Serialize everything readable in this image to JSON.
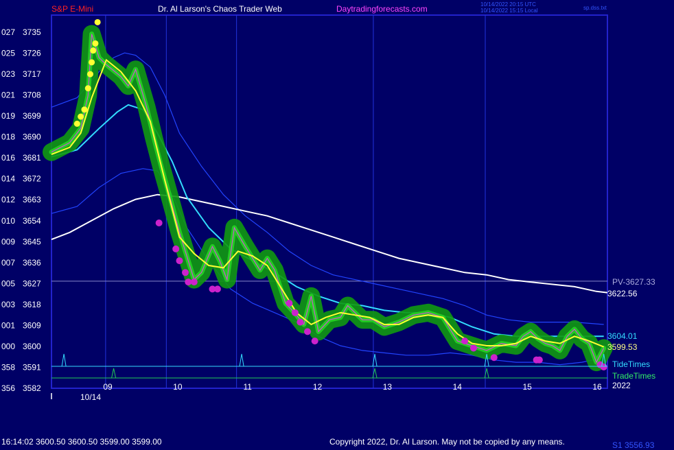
{
  "header": {
    "symbol": "S&P E-Mini",
    "title": "Dr. Al Larson's Chaos Trader Web",
    "site": "Daytradingforecasts.com",
    "utc_stamp": "10/14/2022 20:15 UTC",
    "local_stamp": "10/14/2022 15:15 Local",
    "file": "sp.dss.txt"
  },
  "footer": {
    "quote": "16:14:02  3600.50 3600.50 3599.00 3599.00",
    "copyright": "Copyright 2022, Dr. Al Larson. May not be copied by any means.",
    "cut_value": "S1 3556.93"
  },
  "markers": {
    "pv_label": "PV-3627.33",
    "pv_value": "3622.56",
    "cyan_value": "3604.01",
    "yellow_value": "3599.53",
    "tide": "TideTimes",
    "trade": "TradeTimes",
    "year": "2022",
    "date": "10/14"
  },
  "colors": {
    "background": "#000066",
    "frame": "#2222cc",
    "price": "#22cc22",
    "glow": "#119911",
    "yellow": "#ffff33",
    "cyan": "#33ddff",
    "white": "#ffffff",
    "blue": "#2244ff",
    "magenta": "#cc22cc",
    "header_red": "#ff2222",
    "header_magenta": "#ff44ff"
  },
  "chart_data": {
    "type": "line",
    "xlabel": "",
    "ylabel": "",
    "x_range": [
      8.55,
      16.15
    ],
    "ylim": [
      3582,
      3740
    ],
    "x_ticks": [
      "09",
      "10",
      "11",
      "12",
      "13",
      "14",
      "15",
      "16"
    ],
    "y_ticks": [
      {
        "code": "027",
        "price": "3735"
      },
      {
        "code": "025",
        "price": "3726"
      },
      {
        "code": "023",
        "price": "3717"
      },
      {
        "code": "021",
        "price": "3708"
      },
      {
        "code": "019",
        "price": "3699"
      },
      {
        "code": "018",
        "price": "3690"
      },
      {
        "code": "016",
        "price": "3681"
      },
      {
        "code": "014",
        "price": "3672"
      },
      {
        "code": "012",
        "price": "3663"
      },
      {
        "code": "010",
        "price": "3654"
      },
      {
        "code": "009",
        "price": "3645"
      },
      {
        "code": "007",
        "price": "3636"
      },
      {
        "code": "005",
        "price": "3627"
      },
      {
        "code": "003",
        "price": "3618"
      },
      {
        "code": "001",
        "price": "3609"
      },
      {
        "code": "000",
        "price": "3600"
      },
      {
        "code": "358",
        "price": "3591"
      },
      {
        "code": "356",
        "price": "3582"
      }
    ],
    "vertical_time_lines": [
      9.29,
      10.12,
      11.08,
      12.95,
      14.48
    ],
    "horizontal_line": 3627.33,
    "tide_times": [
      8.72,
      11.15,
      12.97,
      14.5,
      16.1
    ],
    "trade_times": [
      9.4,
      12.97,
      14.5
    ],
    "price": {
      "name": "S&P E-Mini",
      "x": [
        8.55,
        8.8,
        8.95,
        9.05,
        9.1,
        9.2,
        9.3,
        9.5,
        9.6,
        9.7,
        9.85,
        9.95,
        10.05,
        10.15,
        10.3,
        10.5,
        10.6,
        10.75,
        10.85,
        10.95,
        11.05,
        11.2,
        11.4,
        11.5,
        11.6,
        11.75,
        11.9,
        12.0,
        12.1,
        12.2,
        12.35,
        12.5,
        12.6,
        12.8,
        12.95,
        13.1,
        13.3,
        13.5,
        13.7,
        13.9,
        14.1,
        14.3,
        14.5,
        14.7,
        14.9,
        15.0,
        15.1,
        15.2,
        15.3,
        15.4,
        15.5,
        15.6,
        15.7,
        15.8,
        15.9,
        16.0,
        16.1
      ],
      "values": [
        3682,
        3686,
        3692,
        3706,
        3732,
        3722,
        3719,
        3714,
        3710,
        3717,
        3701,
        3688,
        3676,
        3665,
        3648,
        3628,
        3631,
        3642,
        3636,
        3628,
        3650,
        3642,
        3632,
        3637,
        3632,
        3618,
        3613,
        3609,
        3621,
        3606,
        3611,
        3612,
        3617,
        3611,
        3611,
        3608,
        3610,
        3613,
        3614,
        3612,
        3602,
        3600,
        3598,
        3601,
        3600,
        3604,
        3606,
        3603,
        3601,
        3600,
        3598,
        3604,
        3607,
        3603,
        3601,
        3593,
        3599
      ]
    },
    "yellow_ma": {
      "name": "",
      "x": [
        8.55,
        8.8,
        8.95,
        9.1,
        9.3,
        9.5,
        9.7,
        9.9,
        10.1,
        10.3,
        10.5,
        10.7,
        10.9,
        11.1,
        11.3,
        11.5,
        11.7,
        11.9,
        12.1,
        12.3,
        12.5,
        12.7,
        12.9,
        13.1,
        13.3,
        13.5,
        13.7,
        13.9,
        14.1,
        14.3,
        14.5,
        14.7,
        14.9,
        15.1,
        15.3,
        15.5,
        15.7,
        15.9,
        16.1
      ],
      "values": [
        3681,
        3684,
        3690,
        3705,
        3721,
        3716,
        3708,
        3695,
        3670,
        3646,
        3639,
        3634,
        3633,
        3640,
        3638,
        3634,
        3624,
        3614,
        3609,
        3612,
        3614,
        3613,
        3612,
        3609,
        3609,
        3612,
        3613,
        3612,
        3605,
        3601,
        3600,
        3600,
        3601,
        3604,
        3602,
        3601,
        3604,
        3602,
        3599.5
      ]
    },
    "cyan_ma": {
      "name": "",
      "x": [
        8.55,
        8.9,
        9.2,
        9.45,
        9.6,
        9.8,
        10.0,
        10.2,
        10.4,
        10.7,
        11.0,
        11.3,
        11.6,
        11.9,
        12.2,
        12.5,
        12.8,
        13.1,
        13.4,
        13.7,
        14.0,
        14.3,
        14.6,
        14.9,
        15.2,
        15.5,
        15.8,
        16.1
      ],
      "values": [
        3680,
        3683,
        3692,
        3699,
        3702,
        3700,
        3690,
        3678,
        3663,
        3650,
        3641,
        3636,
        3631,
        3625,
        3621,
        3618,
        3617,
        3615,
        3614,
        3614,
        3612,
        3608,
        3605,
        3604,
        3604,
        3604,
        3604,
        3604
      ]
    },
    "white_ma": {
      "name": "",
      "x": [
        8.55,
        8.8,
        9.1,
        9.4,
        9.7,
        10.0,
        10.3,
        10.6,
        10.9,
        11.2,
        11.5,
        11.8,
        12.1,
        12.4,
        12.7,
        13.0,
        13.3,
        13.6,
        13.9,
        14.2,
        14.5,
        14.8,
        15.1,
        15.4,
        15.7,
        16.0,
        16.15
      ],
      "values": [
        3645,
        3648,
        3653,
        3658,
        3662,
        3664,
        3663,
        3661,
        3659,
        3657,
        3655,
        3652,
        3649,
        3646,
        3643,
        3640,
        3637,
        3635,
        3633,
        3631,
        3630,
        3628,
        3627,
        3626,
        3625,
        3623,
        3622.5
      ]
    },
    "upper_band": {
      "name": "",
      "x": [
        8.55,
        8.9,
        9.2,
        9.4,
        9.55,
        9.7,
        9.9,
        10.1,
        10.3,
        10.6,
        10.9,
        11.2,
        11.5,
        11.8,
        12.1,
        12.4,
        12.7,
        13.0,
        13.3,
        13.6,
        13.9,
        14.2,
        14.5,
        14.8,
        15.1,
        15.4,
        15.7,
        16.1
      ],
      "values": [
        3701,
        3705,
        3716,
        3722,
        3724,
        3723,
        3718,
        3706,
        3690,
        3676,
        3664,
        3655,
        3648,
        3640,
        3634,
        3630,
        3628,
        3626,
        3624,
        3622,
        3620,
        3617,
        3613,
        3611,
        3610,
        3610,
        3610,
        3609
      ]
    },
    "lower_band": {
      "name": "",
      "x": [
        8.55,
        8.9,
        9.2,
        9.5,
        9.8,
        10.0,
        10.2,
        10.4,
        10.7,
        11.0,
        11.3,
        11.6,
        11.9,
        12.2,
        12.5,
        12.8,
        13.1,
        13.4,
        13.7,
        14.0,
        14.3,
        14.6,
        14.9,
        15.2,
        15.5,
        15.8,
        16.1
      ],
      "values": [
        3656,
        3659,
        3667,
        3673,
        3675,
        3674,
        3664,
        3650,
        3636,
        3624,
        3618,
        3614,
        3610,
        3604,
        3600,
        3598,
        3597,
        3596,
        3596,
        3597,
        3596,
        3594,
        3593,
        3593,
        3592,
        3593,
        3595
      ]
    },
    "yellow_dots": [
      {
        "x": 8.9,
        "y": 3694
      },
      {
        "x": 8.95,
        "y": 3697
      },
      {
        "x": 9.0,
        "y": 3700
      },
      {
        "x": 9.05,
        "y": 3709
      },
      {
        "x": 9.08,
        "y": 3715
      },
      {
        "x": 9.1,
        "y": 3720
      },
      {
        "x": 9.12,
        "y": 3725
      },
      {
        "x": 9.15,
        "y": 3728
      },
      {
        "x": 9.18,
        "y": 3737
      }
    ],
    "magenta_dots": [
      {
        "x": 10.02,
        "y": 3652
      },
      {
        "x": 10.25,
        "y": 3641
      },
      {
        "x": 10.3,
        "y": 3636
      },
      {
        "x": 10.38,
        "y": 3631
      },
      {
        "x": 10.42,
        "y": 3627
      },
      {
        "x": 10.5,
        "y": 3627
      },
      {
        "x": 10.75,
        "y": 3624
      },
      {
        "x": 10.82,
        "y": 3624
      },
      {
        "x": 11.8,
        "y": 3618
      },
      {
        "x": 11.88,
        "y": 3614
      },
      {
        "x": 11.95,
        "y": 3610
      },
      {
        "x": 12.05,
        "y": 3606
      },
      {
        "x": 12.15,
        "y": 3602
      },
      {
        "x": 14.2,
        "y": 3602
      },
      {
        "x": 14.32,
        "y": 3599
      },
      {
        "x": 14.6,
        "y": 3595
      },
      {
        "x": 15.18,
        "y": 3594
      },
      {
        "x": 15.22,
        "y": 3594
      },
      {
        "x": 16.05,
        "y": 3592
      },
      {
        "x": 16.1,
        "y": 3591
      }
    ]
  }
}
